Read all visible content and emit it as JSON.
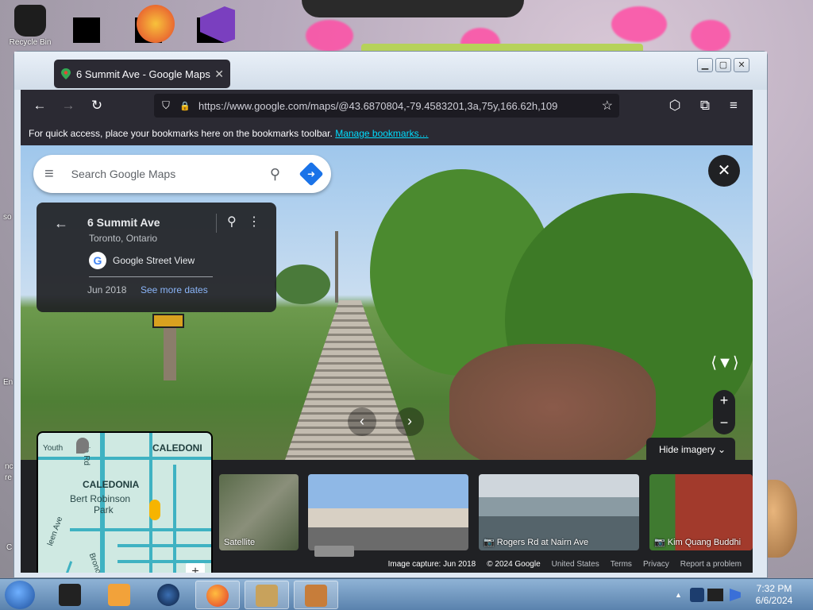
{
  "desktop": {
    "icons": [
      {
        "label": "Recycle Bin"
      },
      {
        "label": ""
      },
      {
        "label": ""
      },
      {
        "label": ""
      }
    ],
    "side_labels": [
      "so",
      "En",
      "nc",
      "re",
      "C"
    ]
  },
  "window": {
    "tab": {
      "title": "6 Summit Ave - Google Maps",
      "close": "✕"
    },
    "controls": {
      "minimize": "▁",
      "maximize": "▢",
      "close": "✕"
    }
  },
  "browser": {
    "url": "https://www.google.com/maps/@43.6870804,-79.4583201,3a,75y,166.62h,109",
    "bookmarks_message": "For quick access, place your bookmarks here on the bookmarks toolbar.",
    "bookmarks_link": "Manage bookmarks…",
    "icons": {
      "back": "←",
      "forward": "→",
      "reload": "↻",
      "shield": "⛉",
      "lock": "🔒",
      "star": "☆",
      "pocket": "⬡",
      "extensions": "⧉",
      "menu": "≡"
    }
  },
  "maps": {
    "search": {
      "placeholder": "Search Google Maps",
      "menu_icon": "≡",
      "search_icon": "⚲",
      "directions_icon": "➜"
    },
    "place": {
      "name": "6 Summit Ave",
      "city": "Toronto, Ontario",
      "provider": "Google Street View",
      "date": "Jun 2018",
      "more_dates": "See more dates",
      "back_icon": "←",
      "pin_icon": "⚲",
      "more_icon": "⋮",
      "g_icon": "G"
    },
    "close_icon": "✕",
    "compass_icon": "⟨▼⟩",
    "zoom": {
      "in": "+",
      "out": "−"
    },
    "arrows": {
      "left": "‹",
      "right": "›"
    },
    "hide_imagery": "Hide imagery ⌄",
    "minimap": {
      "labels": [
        "Youth",
        "CALEDONI",
        "CALEDONIA",
        "Bert Robinson",
        "Park",
        "nia Rd",
        "leen Ave",
        "Bronoco Ave"
      ],
      "zoom_in": "+",
      "zoom_out": "−",
      "fullscreen_icon": "⛶"
    },
    "thumbnails": [
      {
        "caption": "Satellite"
      },
      {
        "caption": ""
      },
      {
        "caption": "📷 Rogers Rd at Nairn Ave"
      },
      {
        "caption": "📷 Kim Quang Buddhi"
      }
    ],
    "footer": [
      "Image capture: Jun 2018",
      "© 2024 Google",
      "United States",
      "Terms",
      "Privacy",
      "Report a problem"
    ]
  },
  "taskbar": {
    "clock_time": "7:32 PM",
    "clock_date": "6/6/2024",
    "tray_arrow": "▲"
  },
  "colors": {
    "accent": "#1a73e8",
    "link": "#00ddff",
    "dark": "#202124"
  }
}
